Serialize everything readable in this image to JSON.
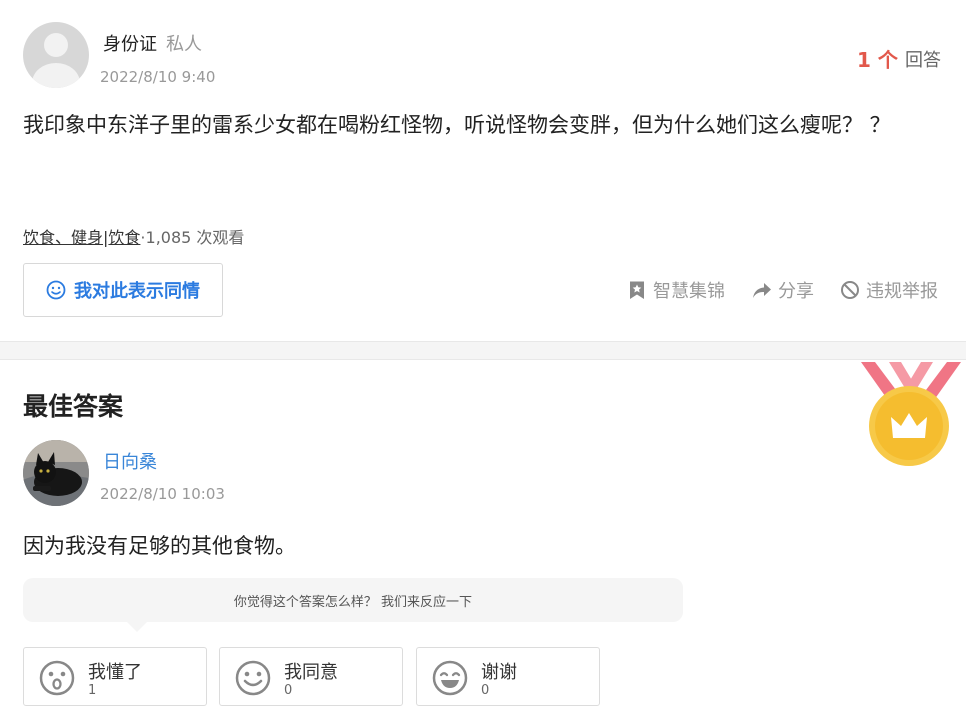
{
  "question": {
    "asker_name": "身份证",
    "asker_private": "私人",
    "time": "2022/8/10 9:40",
    "answer_count": "1 个",
    "answer_count_label": "回答",
    "text": "我印象中东洋子里的雷系少女都在喝粉红怪物，听说怪物会变胖，但为什么她们这么瘦呢？ ？",
    "tags": [
      "饮食、健身",
      "饮食"
    ],
    "tag_separator": "|",
    "views": "·1,085 次观看",
    "sympathy_label": "我对此表示同情",
    "actions": {
      "collect": "智慧集锦",
      "share": "分享",
      "report": "违规举报"
    }
  },
  "best_answer": {
    "section_title": "最佳答案",
    "answerer_name": "日向桑",
    "time": "2022/8/10 10:03",
    "text": "因为我没有足够的其他食物。",
    "feedback_prompt": "你觉得这个答案怎么样？ 我们来反应一下",
    "reactions": [
      {
        "label": "我懂了",
        "count": "1"
      },
      {
        "label": "我同意",
        "count": "0"
      },
      {
        "label": "谢谢",
        "count": "0"
      }
    ]
  },
  "colors": {
    "accent_blue": "#2b7be0",
    "answer_count_red": "#e2584b",
    "medal_gold": "#f7c948",
    "ribbon_pink": "#f07585"
  }
}
